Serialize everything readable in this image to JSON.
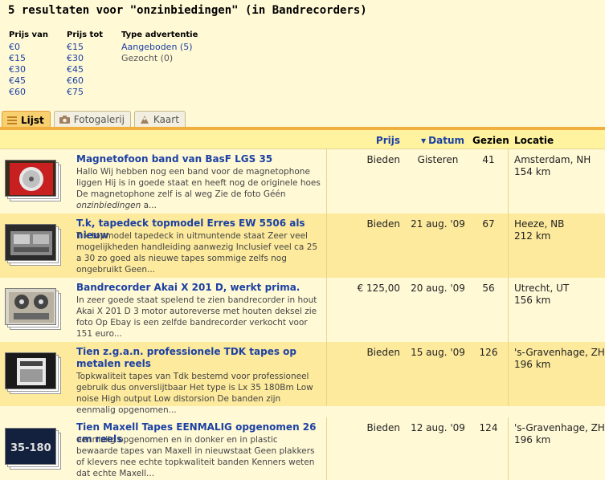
{
  "header": {
    "title": "5 resultaten voor \"onzinbiedingen\"  (in Bandrecorders)"
  },
  "filters": {
    "prijs_van": {
      "label": "Prijs van",
      "options": [
        "€0",
        "€15",
        "€30",
        "€45",
        "€60"
      ]
    },
    "prijs_tot": {
      "label": "Prijs tot",
      "options": [
        "€15",
        "€30",
        "€45",
        "€60",
        "€75"
      ]
    },
    "type": {
      "label": "Type advertentie",
      "aangeboden": "Aangeboden (5)",
      "gezocht": "Gezocht (0)"
    }
  },
  "tabs": [
    {
      "label": "Lijst",
      "icon": "list-icon",
      "active": true
    },
    {
      "label": "Fotogalerij",
      "icon": "camera-icon",
      "active": false
    },
    {
      "label": "Kaart",
      "icon": "map-icon",
      "active": false
    }
  ],
  "columns": {
    "prijs": "Prijs",
    "datum": "Datum",
    "gezien": "Gezien",
    "locatie": "Locatie"
  },
  "colors": {
    "link": "#1c41a3",
    "active_tab": "#f8d070",
    "row_alt": "#fdea9c",
    "background": "#fff9d6"
  },
  "results": [
    {
      "title": "Magnetofoon band van BasF LGS 35",
      "desc_pre": "Hallo Wij hebben nog een band voor de magnetophone liggen Hij is in goede staat en heeft nog de originele hoes De magnetophone zelf is al weg Zie de foto Géén ",
      "desc_em": "onzinbiedingen",
      "desc_post": " a...",
      "prijs": "Bieden",
      "datum": "Gisteren",
      "gezien": "41",
      "plaats": "Amsterdam, NH",
      "afstand": "154 km"
    },
    {
      "title": "T.k, tapedeck topmodel Erres EW 5506 als nieuw",
      "desc_pre": "T k topmodel tapedeck in uitmuntende staat Zeer veel mogelijkheden handleiding aanwezig Inclusief veel ca 25 a 30 zo goed als nieuwe tapes sommige zelfs nog ongebruikt Geen...",
      "desc_em": "",
      "desc_post": "",
      "prijs": "Bieden",
      "datum": "21 aug. '09",
      "gezien": "67",
      "plaats": "Heeze, NB",
      "afstand": "212 km"
    },
    {
      "title": "Bandrecorder Akai X 201 D, werkt prima.",
      "desc_pre": "In zeer goede staat spelend te zien bandrecorder in hout Akai X 201 D 3 motor autoreverse met houten deksel zie foto Op Ebay is een zelfde bandrecorder verkocht voor 151 euro...",
      "desc_em": "",
      "desc_post": "",
      "prijs": "€ 125,00",
      "datum": "20 aug. '09",
      "gezien": "56",
      "plaats": "Utrecht, UT",
      "afstand": "156 km"
    },
    {
      "title": "Tien z.g.a.n. professionele TDK tapes op metalen reels",
      "desc_pre": "Topkwaliteit tapes van Tdk bestemd voor professioneel gebruik dus onverslijtbaar Het type is Lx 35 180Bm Low noise High output Low distorsion De banden zijn eenmalig opgenomen...",
      "desc_em": "",
      "desc_post": "",
      "prijs": "Bieden",
      "datum": "15 aug. '09",
      "gezien": "126",
      "plaats": "'s-Gravenhage, ZH",
      "afstand": "196 km"
    },
    {
      "title": "Tien Maxell Tapes EENMALIG opgenomen 26 cm reels",
      "desc_pre": "eenmalig opgenomen en in donker en in plastic bewaarde tapes van Maxell in nieuwstaat Geen plakkers of klevers nee echte topkwaliteit banden Kenners weten dat echte Maxell...",
      "desc_em": "",
      "desc_post": "",
      "prijs": "Bieden",
      "datum": "12 aug. '09",
      "gezien": "124",
      "plaats": "'s-Gravenhage, ZH",
      "afstand": "196 km",
      "thumb_text": "35-180"
    }
  ]
}
